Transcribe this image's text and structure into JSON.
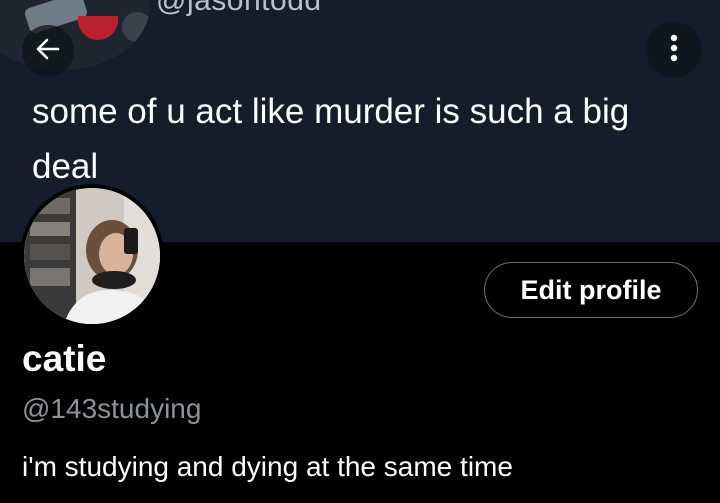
{
  "banner": {
    "handle_text": "@jasontodd",
    "tweet_text": "some of u act like murder is such a big deal"
  },
  "nav": {
    "back_icon": "arrow-left-icon",
    "more_icon": "more-vertical-icon"
  },
  "profile": {
    "display_name": "catie",
    "handle": "@143studying",
    "bio": "i'm studying and dying at the same time",
    "edit_button_label": "Edit profile"
  },
  "colors": {
    "background": "#000000",
    "banner_background": "#151d2d",
    "text_primary": "#ffffff",
    "text_secondary": "#8b9298",
    "button_border": "#6b7277"
  }
}
